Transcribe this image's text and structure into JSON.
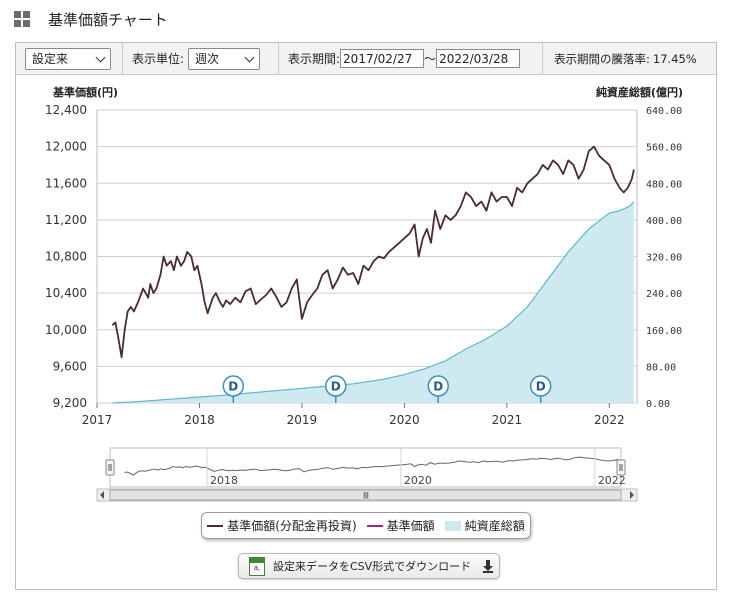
{
  "header": {
    "title": "基準価額チャート",
    "icon": "grid-icon"
  },
  "controls": {
    "period_select": {
      "value": "設定来"
    },
    "unit_label": "表示単位:",
    "unit_select": {
      "value": "週次"
    },
    "period_label": "表示期間:",
    "date_from": "2017/02/27",
    "date_sep": "～",
    "date_to": "2022/03/28",
    "change_label": "表示期間の騰落率:",
    "change_value": "17.45%"
  },
  "chart_data": {
    "type": "line",
    "left_axis_title": "基準価額(円)",
    "right_axis_title": "純資産総額(億円)",
    "x_ticks": [
      "2017",
      "2018",
      "2019",
      "2020",
      "2021",
      "2022"
    ],
    "x_range": [
      2017.0,
      2022.27
    ],
    "y_left_ticks": [
      "9,200",
      "9,600",
      "10,000",
      "10,400",
      "10,800",
      "11,200",
      "11,600",
      "12,000",
      "12,400"
    ],
    "y_left_range": [
      9200,
      12400
    ],
    "y_right_ticks": [
      "0.00",
      "80.00",
      "160.00",
      "240.00",
      "320.00",
      "400.00",
      "480.00",
      "560.00",
      "640.00"
    ],
    "y_right_range": [
      0,
      640
    ],
    "series": [
      {
        "name": "基準価額(分配金再投資)",
        "axis": "left",
        "color": "#4a2b32",
        "x": [
          2017.15,
          2017.18,
          2017.21,
          2017.24,
          2017.27,
          2017.3,
          2017.33,
          2017.36,
          2017.4,
          2017.45,
          2017.5,
          2017.52,
          2017.55,
          2017.58,
          2017.62,
          2017.65,
          2017.68,
          2017.72,
          2017.75,
          2017.78,
          2017.82,
          2017.85,
          2017.88,
          2017.92,
          2017.95,
          2017.98,
          2018.02,
          2018.05,
          2018.08,
          2018.1,
          2018.13,
          2018.16,
          2018.2,
          2018.23,
          2018.26,
          2018.3,
          2018.35,
          2018.4,
          2018.45,
          2018.5,
          2018.55,
          2018.6,
          2018.65,
          2018.7,
          2018.75,
          2018.8,
          2018.85,
          2018.9,
          2018.95,
          2019.0,
          2019.05,
          2019.1,
          2019.15,
          2019.2,
          2019.25,
          2019.3,
          2019.35,
          2019.4,
          2019.45,
          2019.5,
          2019.55,
          2019.6,
          2019.65,
          2019.7,
          2019.75,
          2019.8,
          2019.85,
          2019.9,
          2019.95,
          2020.0,
          2020.05,
          2020.1,
          2020.14,
          2020.18,
          2020.22,
          2020.26,
          2020.3,
          2020.35,
          2020.4,
          2020.45,
          2020.5,
          2020.55,
          2020.6,
          2020.65,
          2020.7,
          2020.75,
          2020.8,
          2020.85,
          2020.9,
          2020.95,
          2021.0,
          2021.05,
          2021.1,
          2021.15,
          2021.2,
          2021.25,
          2021.3,
          2021.35,
          2021.4,
          2021.45,
          2021.5,
          2021.55,
          2021.6,
          2021.65,
          2021.7,
          2021.75,
          2021.8,
          2021.85,
          2021.9,
          2021.95,
          2022.0,
          2022.05,
          2022.1,
          2022.14,
          2022.18,
          2022.22,
          2022.24
        ],
        "values": [
          10050,
          10080,
          9900,
          9700,
          10000,
          10200,
          10250,
          10200,
          10300,
          10450,
          10350,
          10500,
          10400,
          10450,
          10600,
          10800,
          10700,
          10750,
          10650,
          10800,
          10700,
          10750,
          10850,
          10800,
          10650,
          10700,
          10500,
          10300,
          10180,
          10250,
          10350,
          10400,
          10300,
          10250,
          10320,
          10280,
          10350,
          10300,
          10420,
          10450,
          10280,
          10330,
          10380,
          10450,
          10360,
          10250,
          10300,
          10450,
          10550,
          10120,
          10300,
          10380,
          10450,
          10600,
          10650,
          10450,
          10550,
          10680,
          10600,
          10620,
          10500,
          10700,
          10650,
          10750,
          10800,
          10780,
          10850,
          10900,
          10950,
          11000,
          11050,
          11150,
          10800,
          11000,
          11100,
          10950,
          11300,
          11100,
          11250,
          11200,
          11250,
          11350,
          11500,
          11450,
          11350,
          11400,
          11300,
          11500,
          11400,
          11450,
          11450,
          11350,
          11550,
          11500,
          11600,
          11650,
          11700,
          11800,
          11750,
          11850,
          11800,
          11700,
          11850,
          11800,
          11650,
          11750,
          11950,
          12000,
          11900,
          11850,
          11800,
          11650,
          11550,
          11500,
          11550,
          11650,
          11750
        ]
      },
      {
        "name": "基準価額",
        "axis": "left",
        "color": "#b0237a",
        "x": [],
        "values": []
      },
      {
        "name": "純資産総額",
        "axis": "right",
        "color": "#cfe9f0",
        "stroke": "#5fb7cc",
        "x": [
          2017.15,
          2017.4,
          2017.7,
          2018.0,
          2018.3,
          2018.6,
          2018.9,
          2019.2,
          2019.5,
          2019.8,
          2020.0,
          2020.2,
          2020.4,
          2020.6,
          2020.8,
          2021.0,
          2021.2,
          2021.4,
          2021.6,
          2021.8,
          2022.0,
          2022.1,
          2022.2,
          2022.24
        ],
        "values": [
          0,
          3,
          8,
          13,
          18,
          24,
          30,
          36,
          42,
          52,
          62,
          75,
          92,
          118,
          140,
          168,
          210,
          270,
          330,
          380,
          415,
          420,
          430,
          440
        ]
      }
    ],
    "dividend_markers": {
      "label": "D",
      "x": [
        2018.33,
        2019.33,
        2020.33,
        2021.33
      ]
    },
    "navigator": {
      "x_ticks": [
        "2018",
        "2020",
        "2022"
      ],
      "handle_icon": "resize-handle-icon",
      "scroll_grip": "Ⅲ"
    }
  },
  "legend": {
    "items": [
      {
        "label": "基準価額(分配金再投資)"
      },
      {
        "label": "基準価額"
      },
      {
        "label": "純資産総額"
      }
    ]
  },
  "download": {
    "label": "設定来データをCSV形式でダウンロード",
    "icon": "csv-file-icon",
    "arrow_icon": "download-arrow-icon",
    "icon_text": "CSV",
    "icon_glyph": "a,"
  }
}
